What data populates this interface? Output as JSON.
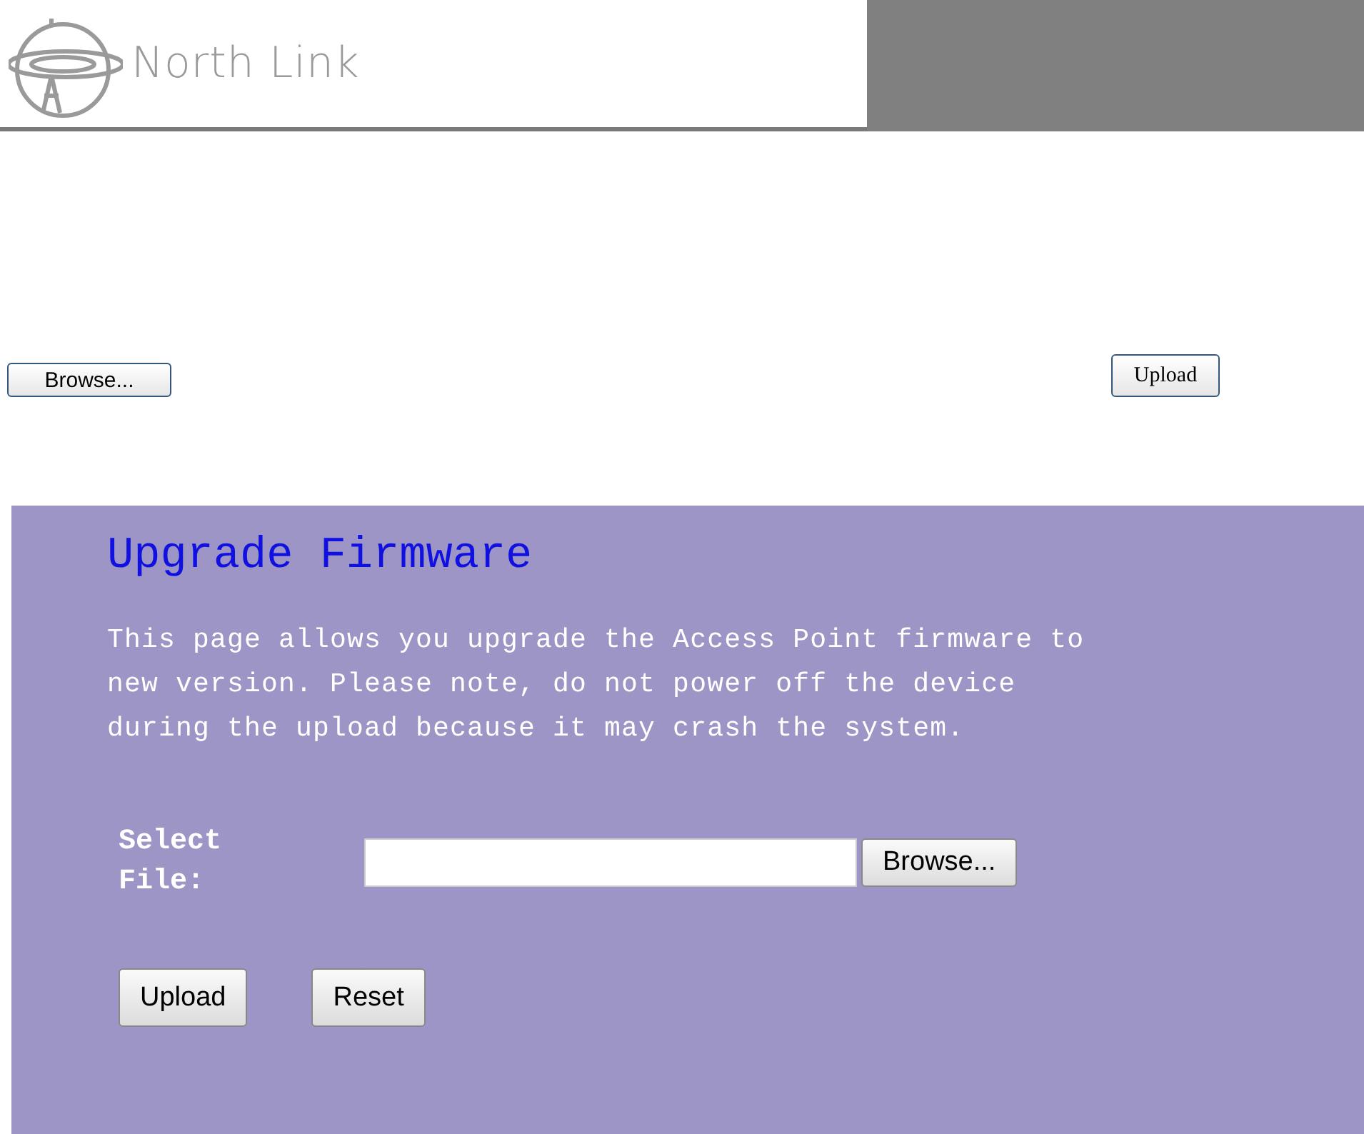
{
  "header": {
    "logo_text": "North Link"
  },
  "buttons": [
    {
      "label": "Browse..."
    },
    {
      "label": "Upload"
    }
  ],
  "screenshot": {
    "title": "Upgrade Firmware",
    "description": "This page allows you upgrade the Access Point firmware to new version. Please note, do not power off the device during the upload because it may crash the system.",
    "file_label": "Select File:",
    "browse_button": "Browse...",
    "actions": [
      "Upload",
      "Reset"
    ]
  }
}
